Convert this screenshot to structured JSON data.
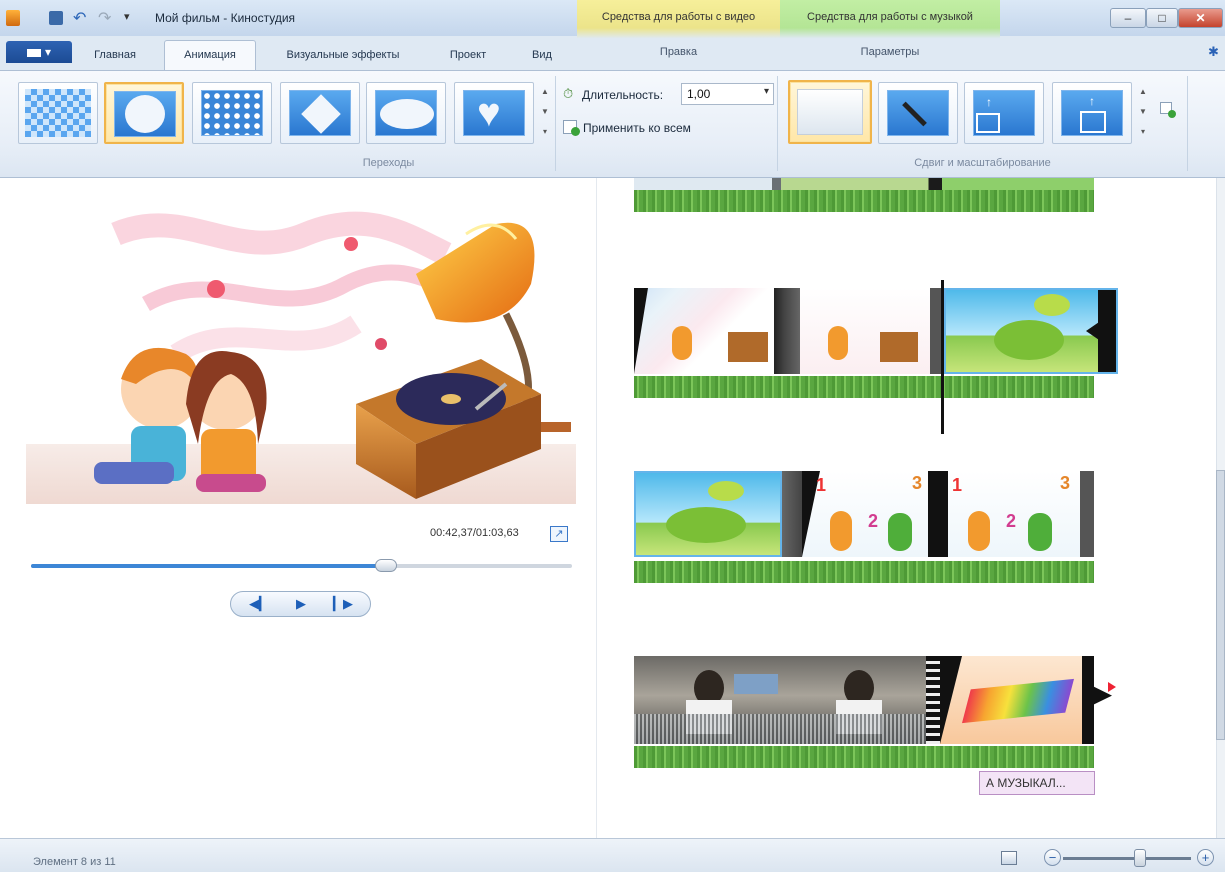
{
  "window": {
    "title": "Мой фильм - Киностудия"
  },
  "context_tabs": {
    "video": "Средства для работы с видео",
    "music": "Средства для работы с музыкой"
  },
  "context_groups": {
    "video_edit": "Правка",
    "music_params": "Параметры"
  },
  "file_menu": {
    "label": "▾"
  },
  "tabs": [
    {
      "label": "Главная",
      "active": false
    },
    {
      "label": "Анимация",
      "active": true
    },
    {
      "label": "Визуальные эффекты",
      "active": false
    },
    {
      "label": "Проект",
      "active": false
    },
    {
      "label": "Вид",
      "active": false
    }
  ],
  "ribbon": {
    "transitions": {
      "group_label": "Переходы",
      "items": [
        "checker",
        "circle",
        "dots",
        "diamond",
        "ellipse",
        "heart"
      ],
      "selected": "circle"
    },
    "duration": {
      "label": "Длительность:",
      "value": "1,00"
    },
    "apply_all": {
      "label": "Применить ко всем"
    },
    "pan_zoom": {
      "group_label": "Сдвиг и масштабирование",
      "items": [
        "none",
        "auto",
        "pan-up-left",
        "pan-up"
      ],
      "selected": "none"
    }
  },
  "preview": {
    "timecode": "00:42,37/01:03,63",
    "seek_fraction": 0.656
  },
  "storyboard": {
    "caption": "А МУЗЫКАЛ..."
  },
  "status": {
    "text": "Элемент 8 из 11",
    "zoom_fraction": 0.6
  },
  "colors": {
    "accent": "#3d86d6",
    "selection": "#f0b44a",
    "audio": "#5aa740"
  }
}
